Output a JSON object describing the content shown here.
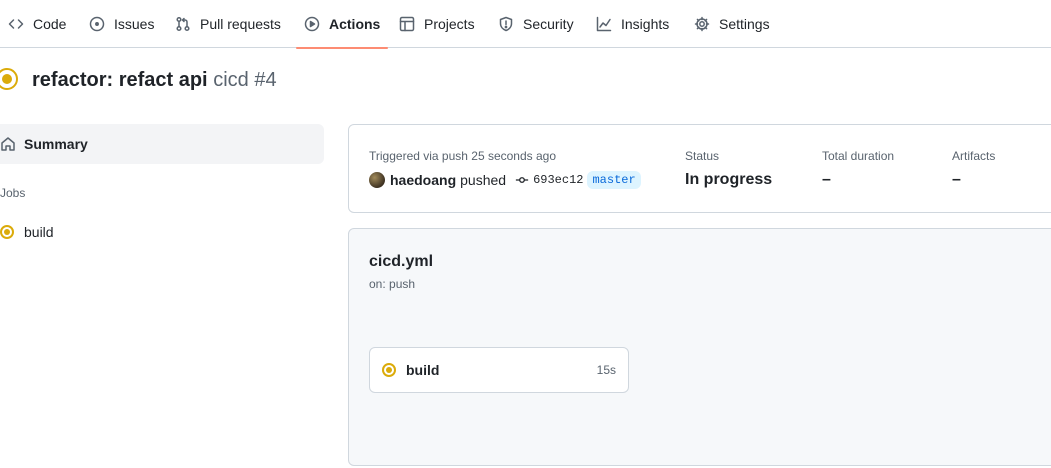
{
  "nav": {
    "tabs": [
      {
        "label": "Code",
        "icon": "code-icon"
      },
      {
        "label": "Issues",
        "icon": "issue-icon"
      },
      {
        "label": "Pull requests",
        "icon": "pull-request-icon"
      },
      {
        "label": "Actions",
        "icon": "play-icon",
        "active": true
      },
      {
        "label": "Projects",
        "icon": "table-icon"
      },
      {
        "label": "Security",
        "icon": "shield-icon"
      },
      {
        "label": "Insights",
        "icon": "graph-icon"
      },
      {
        "label": "Settings",
        "icon": "gear-icon"
      }
    ],
    "active_underline_color": "#fd8c73"
  },
  "run": {
    "title": "refactor: refact api",
    "workflow": "cicd",
    "number": "#4",
    "status_color": "#dbab0a"
  },
  "sidebar": {
    "summary_label": "Summary",
    "jobs_heading": "Jobs",
    "jobs": [
      {
        "label": "build",
        "status": "in-progress"
      }
    ]
  },
  "summary": {
    "trigger_text": "Triggered via push 25 seconds ago",
    "actor": "haedoang",
    "action": "pushed",
    "commit_sha": "693ec12",
    "branch": "master",
    "status_label": "Status",
    "status_value": "In progress",
    "duration_label": "Total duration",
    "duration_value": "–",
    "artifacts_label": "Artifacts",
    "artifacts_value": "–"
  },
  "graph": {
    "workflow_file": "cicd.yml",
    "trigger": "on: push",
    "job": {
      "name": "build",
      "duration": "15s"
    }
  }
}
